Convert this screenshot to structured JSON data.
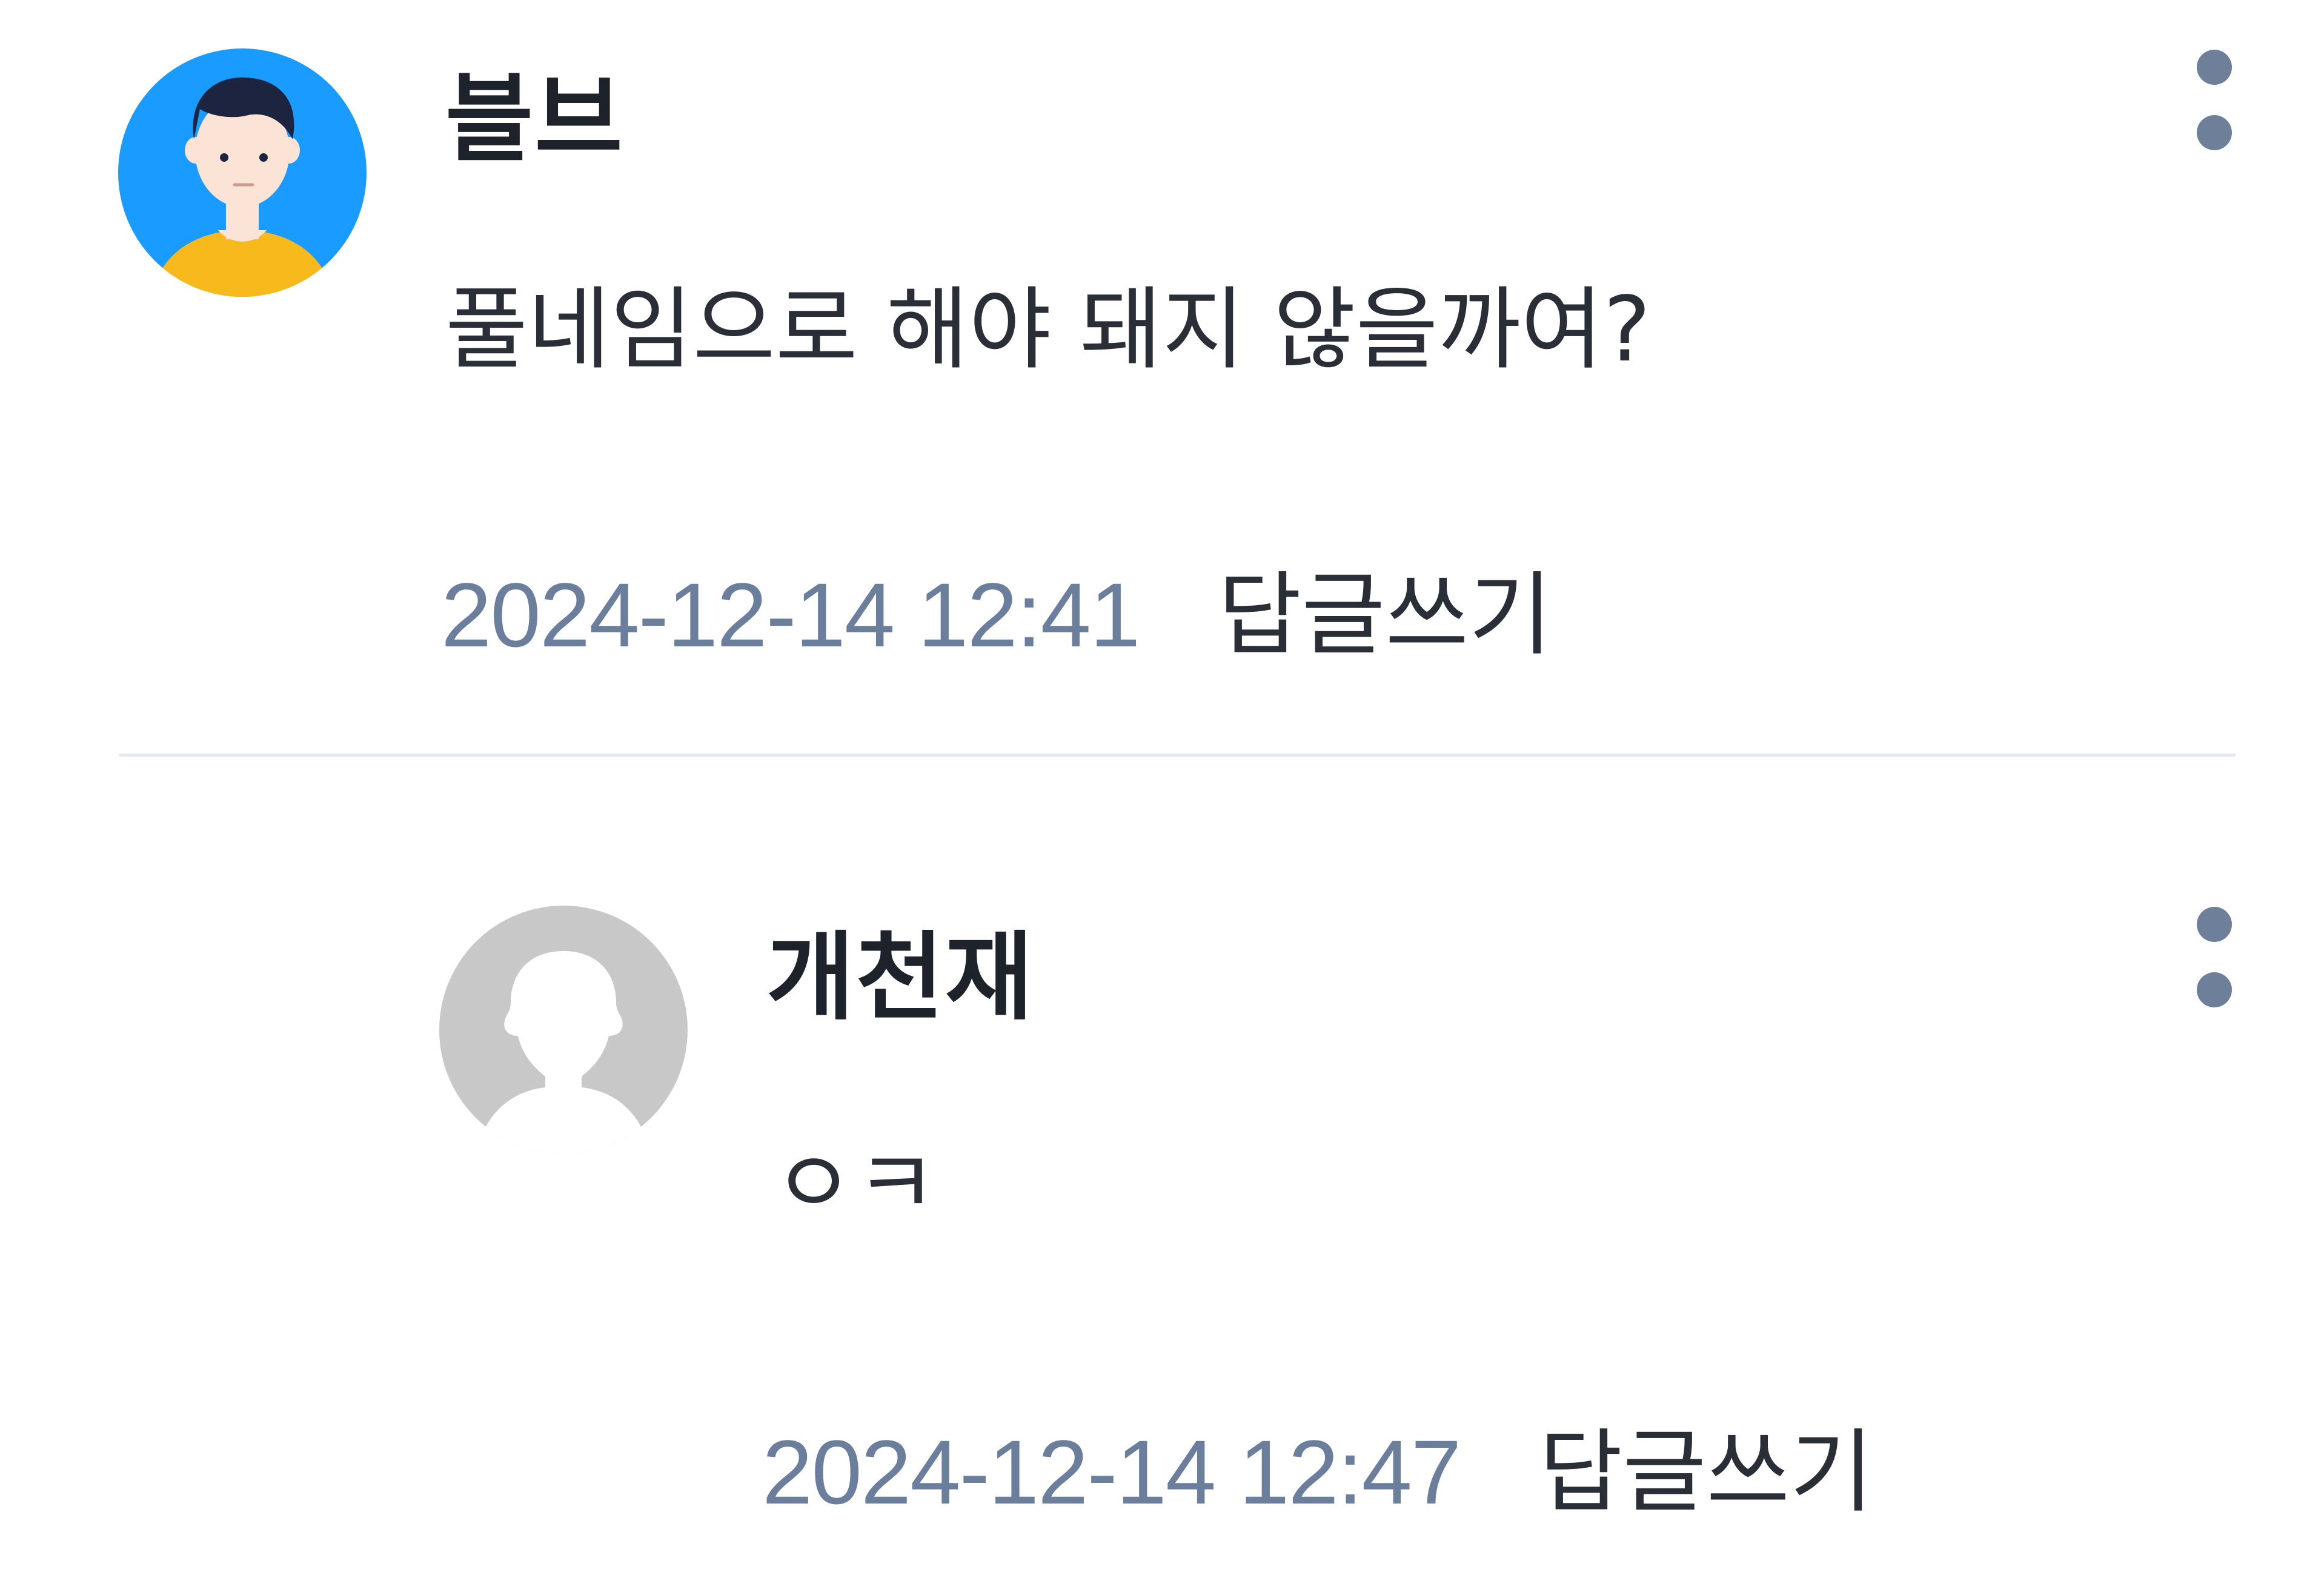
{
  "comments": [
    {
      "author": "블브",
      "avatar_icon": "user-avatar-icon",
      "text": "풀네임으로 해야 돼지 않을까여?",
      "timestamp": "2024-12-14 12:41",
      "reply_label": "답글쓰기",
      "menu_icon": "more-options-icon"
    },
    {
      "author": "개천재",
      "avatar_icon": "default-avatar-icon",
      "text": "ㅇㅋ",
      "timestamp": "2024-12-14 12:47",
      "reply_label": "답글쓰기",
      "menu_icon": "more-options-icon",
      "is_reply": true
    }
  ],
  "colors": {
    "timestamp": "#6b7f9d",
    "avatar_blue": "#1a9bff",
    "avatar_shirt": "#f7b91b",
    "default_avatar": "#c8c8c8",
    "menu_dot": "#6e7f99",
    "divider": "#e4e7ef"
  }
}
